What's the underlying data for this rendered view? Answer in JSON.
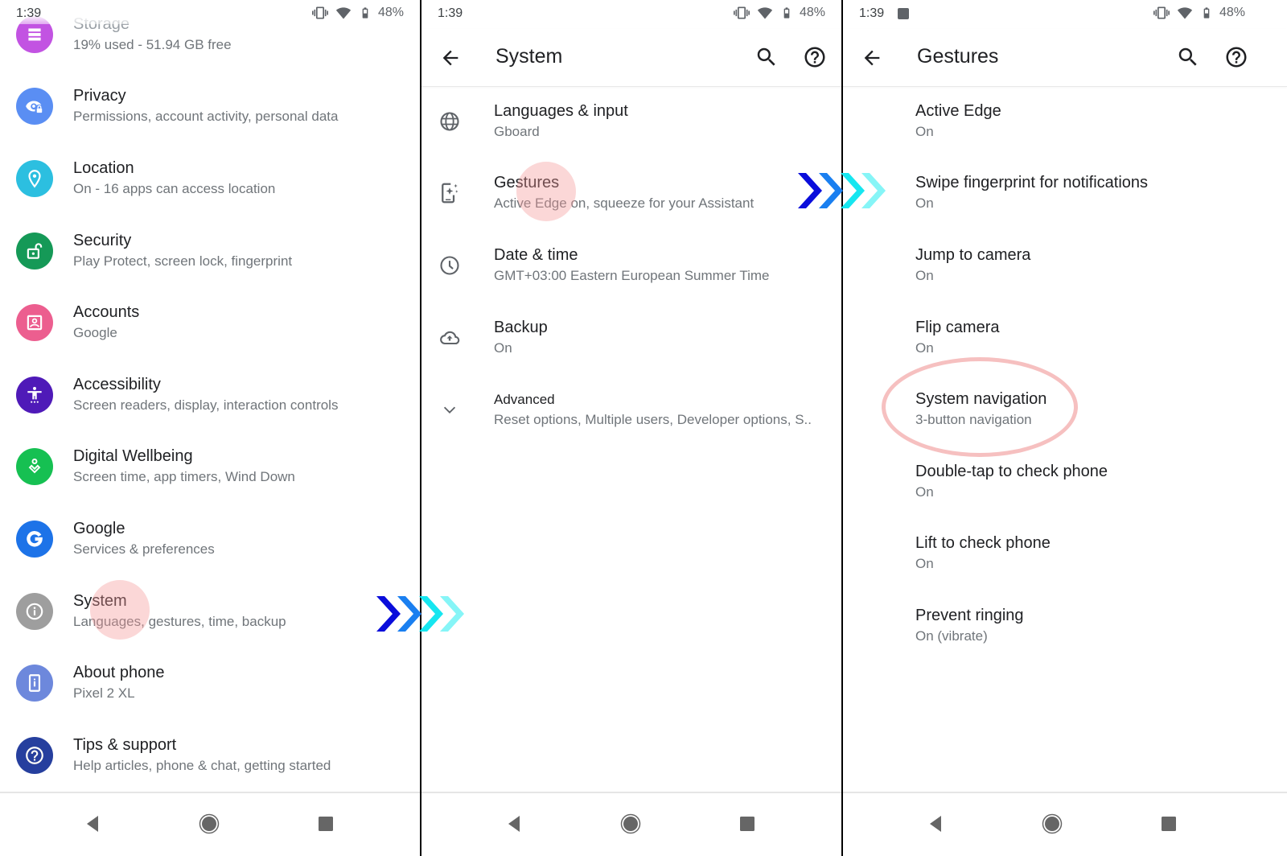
{
  "status_bar": {
    "time": "1:39",
    "battery": "48%"
  },
  "colors": {
    "storage": "#c253e2",
    "privacy": "#5a8ef3",
    "location": "#2cbfe0",
    "security": "#159957",
    "accounts": "#ec5e8f",
    "accessibility": "#4f1ab8",
    "wellbeing": "#16c052",
    "google": "#1d73e8",
    "system": "#9e9e9e",
    "about": "#6d88dc",
    "tips": "#263f9e",
    "tap_highlight": "#f59696",
    "arrow_1": "#0a0ddb",
    "arrow_2": "#1a7ff0",
    "arrow_3": "#16e6f0",
    "arrow_4": "#86f5f7"
  },
  "panel1": {
    "items": [
      {
        "icon": "storage-icon",
        "title": "Storage",
        "subtitle": "19% used - 51.94 GB free"
      },
      {
        "icon": "privacy-icon",
        "title": "Privacy",
        "subtitle": "Permissions, account activity, personal data"
      },
      {
        "icon": "location-icon",
        "title": "Location",
        "subtitle": "On - 16 apps can access location"
      },
      {
        "icon": "security-icon",
        "title": "Security",
        "subtitle": "Play Protect, screen lock, fingerprint"
      },
      {
        "icon": "accounts-icon",
        "title": "Accounts",
        "subtitle": "Google"
      },
      {
        "icon": "accessibility-icon",
        "title": "Accessibility",
        "subtitle": "Screen readers, display, interaction controls"
      },
      {
        "icon": "digital-wellbeing-icon",
        "title": "Digital Wellbeing",
        "subtitle": "Screen time, app timers, Wind Down"
      },
      {
        "icon": "google-icon",
        "title": "Google",
        "subtitle": "Services & preferences"
      },
      {
        "icon": "system-info-icon",
        "title": "System",
        "subtitle": "Languages, gestures, time, backup"
      },
      {
        "icon": "about-phone-icon",
        "title": "About phone",
        "subtitle": "Pixel 2 XL"
      },
      {
        "icon": "tips-support-icon",
        "title": "Tips & support",
        "subtitle": "Help articles, phone & chat, getting started"
      }
    ]
  },
  "panel2": {
    "title": "System",
    "items": [
      {
        "icon": "globe-icon",
        "title": "Languages & input",
        "subtitle": "Gboard"
      },
      {
        "icon": "gestures-icon",
        "title": "Gestures",
        "subtitle": "Active Edge on, squeeze for your Assistant"
      },
      {
        "icon": "clock-icon",
        "title": "Date & time",
        "subtitle": "GMT+03:00 Eastern European Summer Time"
      },
      {
        "icon": "cloud-upload-icon",
        "title": "Backup",
        "subtitle": "On"
      },
      {
        "icon": "chevron-down-icon",
        "title": "Advanced",
        "subtitle": "Reset options, Multiple users, Developer options, S.."
      }
    ]
  },
  "panel3": {
    "title": "Gestures",
    "items": [
      {
        "title": "Active Edge",
        "subtitle": "On"
      },
      {
        "title": "Swipe fingerprint for notifications",
        "subtitle": "On"
      },
      {
        "title": "Jump to camera",
        "subtitle": "On"
      },
      {
        "title": "Flip camera",
        "subtitle": "On"
      },
      {
        "title": "System navigation",
        "subtitle": "3-button navigation"
      },
      {
        "title": "Double-tap to check phone",
        "subtitle": "On"
      },
      {
        "title": "Lift to check phone",
        "subtitle": "On"
      },
      {
        "title": "Prevent ringing",
        "subtitle": "On (vibrate)"
      }
    ]
  }
}
